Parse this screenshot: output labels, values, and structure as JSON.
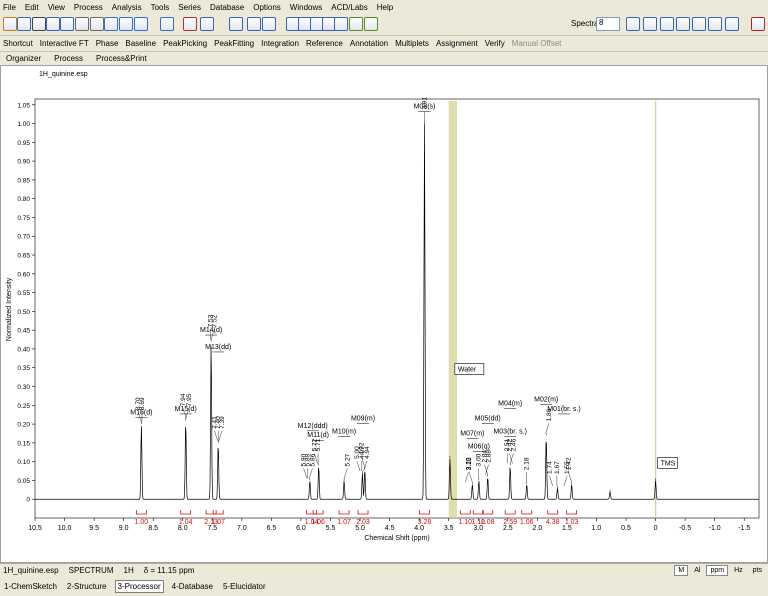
{
  "menu": [
    "File",
    "Edit",
    "View",
    "Process",
    "Analysis",
    "Tools",
    "Series",
    "Database",
    "Options",
    "Windows",
    "ACD/Labs",
    "Help"
  ],
  "toolbar": {
    "spectra_label": "Spectra",
    "spectra_value": "8",
    "icons": [
      "open-icon",
      "save-icon",
      "print-icon",
      "copy-icon",
      "paste-icon",
      "undo-icon",
      "select-icon",
      "zoom-in-icon",
      "zoom-out-icon",
      "zoom-fit-icon",
      "magnify-icon",
      "peak-icon",
      "integral-icon",
      "phase-icon",
      "baseline-icon",
      "window-icon",
      "layout-icon",
      "layout2-icon",
      "layout3-icon",
      "layout4-icon",
      "layout5-icon",
      "arrange-icon",
      "arrange2-icon",
      "table-icon",
      "grid-icon",
      "close-icon"
    ]
  },
  "toolbar2": [
    "Shortcut",
    "Interactive FT",
    "Phase",
    "Baseline",
    "PeakPicking",
    "PeakFitting",
    "Integration",
    "Reference",
    "Annotation",
    "Multiplets",
    "Assignment",
    "Verify",
    "Manual Offset"
  ],
  "tabs": [
    "Organizer",
    "Process",
    "Process&Print"
  ],
  "document_title": "1H_quinine.esp",
  "chart_data": {
    "type": "line",
    "xlabel": "Chemical Shift (ppm)",
    "ylabel": "Normalized Intensity",
    "xlim": [
      10.5,
      -1.75
    ],
    "ylim": [
      -0.05,
      1.06
    ],
    "x_ticks": [
      "10.5",
      "10.0",
      "9.5",
      "9.0",
      "8.5",
      "8.0",
      "7.5",
      "7.0",
      "6.5",
      "6.0",
      "5.5",
      "5.0",
      "4.5",
      "4.0",
      "3.5",
      "3.0",
      "2.5",
      "2.0",
      "1.5",
      "1.0",
      "0.5",
      "0",
      "-0.5",
      "-1.0",
      "-1.5"
    ],
    "y_ticks": [
      "0",
      "0.05",
      "0.10",
      "0.15",
      "0.20",
      "0.25",
      "0.30",
      "0.35",
      "0.40",
      "0.45",
      "0.50",
      "0.55",
      "0.60",
      "0.65",
      "0.70",
      "0.75",
      "0.80",
      "0.85",
      "0.90",
      "0.95",
      "1.00",
      "1.05"
    ],
    "peaks": [
      {
        "x": 8.7,
        "y": 0.2
      },
      {
        "x": 7.95,
        "y": 0.21
      },
      {
        "x": 7.52,
        "y": 0.42
      },
      {
        "x": 7.4,
        "y": 0.15
      },
      {
        "x": 5.85,
        "y": 0.05
      },
      {
        "x": 5.7,
        "y": 0.09
      },
      {
        "x": 5.27,
        "y": 0.05
      },
      {
        "x": 4.96,
        "y": 0.07
      },
      {
        "x": 4.92,
        "y": 0.08
      },
      {
        "x": 3.91,
        "y": 1.0
      },
      {
        "x": 3.48,
        "y": 0.11
      },
      {
        "x": 3.1,
        "y": 0.04
      },
      {
        "x": 2.99,
        "y": 0.05
      },
      {
        "x": 2.84,
        "y": 0.06
      },
      {
        "x": 2.46,
        "y": 0.09
      },
      {
        "x": 2.18,
        "y": 0.04
      },
      {
        "x": 1.85,
        "y": 0.17
      },
      {
        "x": 1.66,
        "y": 0.03
      },
      {
        "x": 1.42,
        "y": 0.04
      },
      {
        "x": 0.77,
        "y": 0.02
      },
      {
        "x": 0.0,
        "y": 0.05
      }
    ],
    "peak_labels": [
      {
        "x": 8.7,
        "text": "8.70"
      },
      {
        "x": 8.69,
        "text": "8.69"
      },
      {
        "x": 7.95,
        "text": "7.95"
      },
      {
        "x": 7.94,
        "text": "7.94"
      },
      {
        "x": 7.53,
        "text": "7.53"
      },
      {
        "x": 7.52,
        "text": "7.52"
      },
      {
        "x": 7.41,
        "text": "7.41"
      },
      {
        "x": 7.4,
        "text": "7.40"
      },
      {
        "x": 7.39,
        "text": "7.39"
      },
      {
        "x": 5.9,
        "text": "5.90"
      },
      {
        "x": 5.89,
        "text": "5.89"
      },
      {
        "x": 5.86,
        "text": "5.86"
      },
      {
        "x": 5.72,
        "text": "5.72"
      },
      {
        "x": 5.71,
        "text": "5.71"
      },
      {
        "x": 5.27,
        "text": "5.27"
      },
      {
        "x": 5.0,
        "text": "5.00"
      },
      {
        "x": 4.97,
        "text": "4.97"
      },
      {
        "x": 4.94,
        "text": "4.94"
      },
      {
        "x": 4.92,
        "text": "4.92"
      },
      {
        "x": 3.91,
        "text": "3.91"
      },
      {
        "x": 3.22,
        "text": "3.22"
      },
      {
        "x": 3.1,
        "text": "3.10"
      },
      {
        "x": 3.0,
        "text": "3.00"
      },
      {
        "x": 2.88,
        "text": "2.88"
      },
      {
        "x": 2.84,
        "text": "2.84"
      },
      {
        "x": 2.51,
        "text": "2.51"
      },
      {
        "x": 2.46,
        "text": "2.46"
      },
      {
        "x": 2.42,
        "text": "2.42"
      },
      {
        "x": 2.18,
        "text": "2.18"
      },
      {
        "x": 1.86,
        "text": "1.86"
      },
      {
        "x": 1.74,
        "text": "1.74"
      },
      {
        "x": 1.67,
        "text": "1.67"
      },
      {
        "x": 1.55,
        "text": "1.55"
      },
      {
        "x": 1.42,
        "text": "1.42"
      }
    ],
    "multiplets": [
      {
        "x": 8.7,
        "y": 0.225,
        "text": "M16(d)"
      },
      {
        "x": 7.95,
        "y": 0.235,
        "text": "M15(d)"
      },
      {
        "x": 7.52,
        "y": 0.445,
        "text": "M14(d)"
      },
      {
        "x": 7.4,
        "y": 0.4,
        "text": "M13(dd)"
      },
      {
        "x": 5.8,
        "y": 0.19,
        "text": "M12(ddd)"
      },
      {
        "x": 5.71,
        "y": 0.165,
        "text": "M11(d)"
      },
      {
        "x": 5.27,
        "y": 0.175,
        "text": "M10(m)"
      },
      {
        "x": 4.95,
        "y": 0.21,
        "text": "M09(m)"
      },
      {
        "x": 3.91,
        "y": 1.04,
        "text": "M08(s)"
      },
      {
        "x": 3.1,
        "y": 0.17,
        "text": "M07(m)"
      },
      {
        "x": 2.99,
        "y": 0.135,
        "text": "M06(q)"
      },
      {
        "x": 2.84,
        "y": 0.21,
        "text": "M05(dd)"
      },
      {
        "x": 2.46,
        "y": 0.25,
        "text": "M04(m)"
      },
      {
        "x": 2.46,
        "y": 0.175,
        "text": "M03(br. s.)"
      },
      {
        "x": 1.85,
        "y": 0.26,
        "text": "M02(m)"
      },
      {
        "x": 1.55,
        "y": 0.235,
        "text": "M01(br. s.)"
      }
    ],
    "integrals": [
      {
        "x": 8.7,
        "text": "1.00"
      },
      {
        "x": 7.95,
        "text": "1.04"
      },
      {
        "x": 7.52,
        "text": "2.13"
      },
      {
        "x": 7.4,
        "text": "1.07"
      },
      {
        "x": 5.82,
        "text": "1.04"
      },
      {
        "x": 5.71,
        "text": "1.06"
      },
      {
        "x": 5.27,
        "text": "1.07"
      },
      {
        "x": 4.95,
        "text": "2.03"
      },
      {
        "x": 3.91,
        "text": "3.28"
      },
      {
        "x": 3.22,
        "text": "1.10"
      },
      {
        "x": 3.0,
        "text": "1.10"
      },
      {
        "x": 2.84,
        "text": "1.08"
      },
      {
        "x": 2.46,
        "text": "2.59"
      },
      {
        "x": 2.18,
        "text": "1.06"
      },
      {
        "x": 1.74,
        "text": "4.38"
      },
      {
        "x": 1.42,
        "text": "1.03"
      }
    ],
    "annotations": [
      {
        "x": 3.43,
        "text": "Water"
      },
      {
        "x": 0.0,
        "text": "TMS"
      }
    ],
    "highlight_band": [
      3.5,
      3.36
    ]
  },
  "status": {
    "file": "1H_quinine.esp",
    "type": "SPECTRUM",
    "nucleus": "1H",
    "delta": "δ = 11.15 ppm",
    "units": [
      "M",
      "Al",
      "ppm",
      "Hz",
      "pts"
    ]
  },
  "bottom_tabs": [
    "1-ChemSketch",
    "2-Structure",
    "3-Processor",
    "4-Database",
    "5-Elucidator"
  ]
}
